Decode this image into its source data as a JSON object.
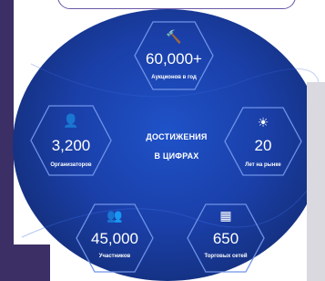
{
  "stats": {
    "auctions": {
      "icon": "gavel-icon",
      "value": "60,000+",
      "label": "Аукционов в год"
    },
    "organizers": {
      "icon": "person-icon",
      "value": "3,200",
      "label": "Организаторов"
    },
    "years": {
      "icon": "sun-icon",
      "value": "20",
      "label": "Лет на рынке"
    },
    "participants": {
      "icon": "group-icon",
      "value": "45,000",
      "label": "Участников"
    },
    "retail": {
      "icon": "building-icon",
      "value": "650",
      "label": "Торговых сетей"
    }
  },
  "center": {
    "line1": "ДОСТИЖЕНИЯ",
    "line2": "В ЦИФРАХ"
  },
  "colors": {
    "blob": "#1a3fa8",
    "panel": "#3b2f66",
    "hex_border": "#6f93e8"
  }
}
